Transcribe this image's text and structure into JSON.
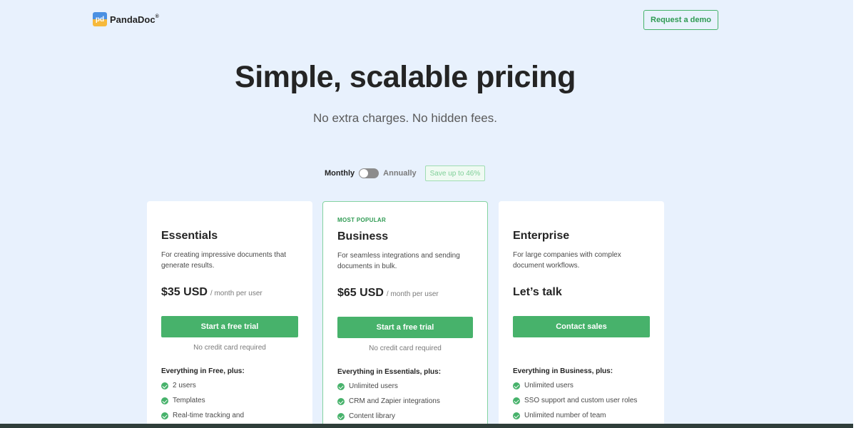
{
  "header": {
    "logo_text": "PandaDoc",
    "logo_mark": "pd",
    "logo_reg": "®",
    "demo_button": "Request a demo"
  },
  "hero": {
    "title": "Simple, scalable pricing",
    "subtitle": "No extra charges. No hidden fees."
  },
  "billing": {
    "monthly": "Monthly",
    "annually": "Annually",
    "save_badge": "Save up to 46%",
    "selected": "Monthly"
  },
  "plans": [
    {
      "name": "Essentials",
      "description": "For creating impressive documents that generate results.",
      "price": "$35 USD",
      "price_unit": "/ month per user",
      "cta": "Start a free trial",
      "note": "No credit card required",
      "features_head": "Everything in Free, plus:",
      "features": [
        "2 users",
        "Templates",
        "Real-time tracking and"
      ]
    },
    {
      "tag": "MOST POPULAR",
      "name": "Business",
      "description": "For seamless integrations and sending documents in bulk.",
      "price": "$65 USD",
      "price_unit": "/ month per user",
      "cta": "Start a free trial",
      "note": "No credit card required",
      "features_head": "Everything in Essentials, plus:",
      "features": [
        "Unlimited users",
        "CRM and Zapier integrations",
        "Content library"
      ]
    },
    {
      "name": "Enterprise",
      "description": "For large companies with complex document workflows.",
      "price": "Let’s talk",
      "cta": "Contact sales",
      "features_head": "Everything in Business, plus:",
      "features": [
        "Unlimited users",
        "SSO support and custom user roles",
        "Unlimited number of team"
      ]
    }
  ],
  "colors": {
    "background": "#e8f1fd",
    "accent": "#47b26b",
    "text": "#242424"
  }
}
